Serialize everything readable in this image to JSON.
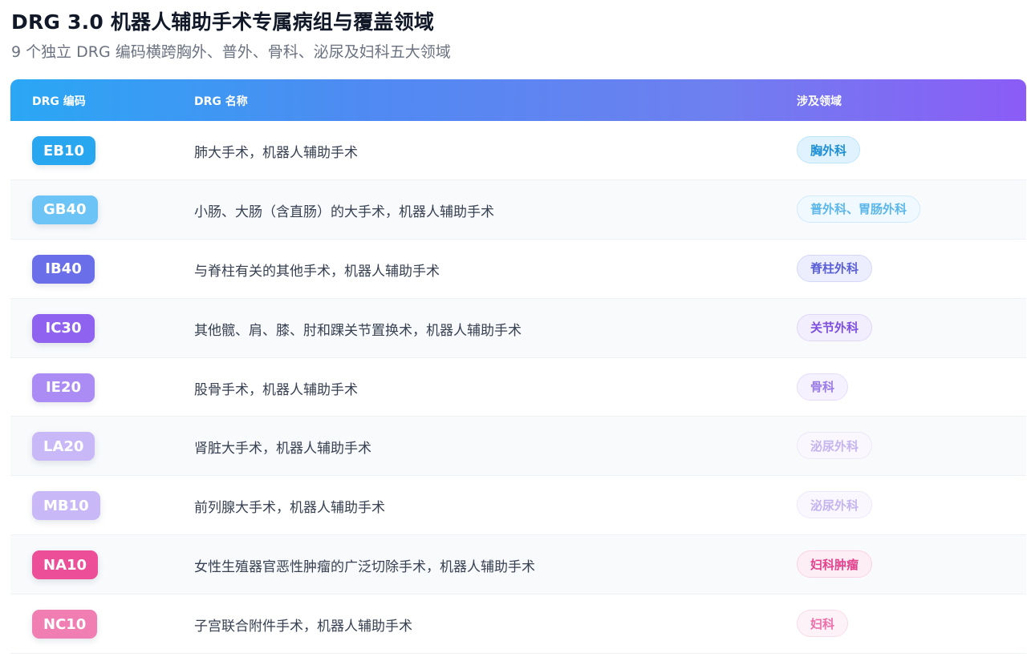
{
  "title": "DRG 3.0 机器人辅助手术专属病组与覆盖领域",
  "subtitle": "9 个独立 DRG 编码横跨胸外、普外、骨科、泌尿及妇科五大领域",
  "headers": {
    "code": "DRG 编码",
    "name": "DRG 名称",
    "area": "涉及领域"
  },
  "rows": [
    {
      "code": "EB10",
      "name": "肺大手术，机器人辅助手术",
      "area": "胸外科",
      "badge_color": "#28a6f0",
      "pill_bg": "#e0f2fe",
      "pill_border": "#bae6fd",
      "pill_text": "#1e8fd6"
    },
    {
      "code": "GB40",
      "name": "小肠、大肠（含直肠）的大手术，机器人辅助手术",
      "area": "普外科、胃肠外科",
      "badge_color": "#6cc3f5",
      "pill_bg": "#f0f9ff",
      "pill_border": "#cfeafc",
      "pill_text": "#5bb6ea"
    },
    {
      "code": "IB40",
      "name": "与脊柱有关的其他手术，机器人辅助手术",
      "area": "脊柱外科",
      "badge_color": "#6a6ee8",
      "pill_bg": "#eceefd",
      "pill_border": "#d4d7fa",
      "pill_text": "#5b5fd6"
    },
    {
      "code": "IC30",
      "name": "其他髋、肩、膝、肘和踝关节置换术，机器人辅助手术",
      "area": "关节外科",
      "badge_color": "#8f63ef",
      "pill_bg": "#f3eefe",
      "pill_border": "#e0d5fb",
      "pill_text": "#7c4fe0"
    },
    {
      "code": "IE20",
      "name": "股骨手术，机器人辅助手术",
      "area": "骨科",
      "badge_color": "#ab8cf5",
      "pill_bg": "#f5f1fe",
      "pill_border": "#e6ddfb",
      "pill_text": "#9a7be8"
    },
    {
      "code": "LA20",
      "name": "肾脏大手术，机器人辅助手术",
      "area": "泌尿外科",
      "badge_color": "#c9b8f8",
      "pill_bg": "#faf8fe",
      "pill_border": "#ede8fb",
      "pill_text": "#c4b4ef"
    },
    {
      "code": "MB10",
      "name": "前列腺大手术，机器人辅助手术",
      "area": "泌尿外科",
      "badge_color": "#c9b8f8",
      "pill_bg": "#faf8fe",
      "pill_border": "#ede8fb",
      "pill_text": "#c4b4ef"
    },
    {
      "code": "NA10",
      "name": "女性生殖器官恶性肿瘤的广泛切除手术，机器人辅助手术",
      "area": "妇科肿瘤",
      "badge_color": "#ec4f97",
      "pill_bg": "#fdeef5",
      "pill_border": "#f9d3e5",
      "pill_text": "#e4428d"
    },
    {
      "code": "NC10",
      "name": "子宫联合附件手术，机器人辅助手术",
      "area": "妇科",
      "badge_color": "#f17eb3",
      "pill_bg": "#fdf2f7",
      "pill_border": "#fadbe9",
      "pill_text": "#ee6fa9"
    }
  ]
}
